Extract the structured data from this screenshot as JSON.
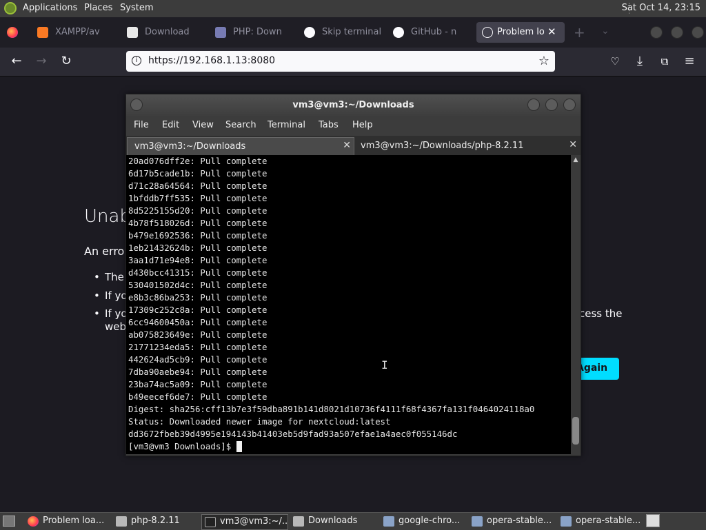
{
  "top_panel": {
    "applications": "Applications",
    "places": "Places",
    "system": "System",
    "clock": "Sat Oct 14, 23:15"
  },
  "browser": {
    "tabs": [
      {
        "label": "XAMPP/av",
        "icon": "xampp-icon"
      },
      {
        "label": "Download",
        "icon": "download-page-icon"
      },
      {
        "label": "PHP: Down",
        "icon": "php-icon"
      },
      {
        "label": "Skip terminal",
        "icon": "github-icon"
      },
      {
        "label": "GitHub - n",
        "icon": "github-icon"
      },
      {
        "label": "Problem lo",
        "icon": "info-icon"
      }
    ],
    "url": "https://192.168.1.13:8080"
  },
  "error_page": {
    "title_fragment": "Unab",
    "intro_fragment": "An erro",
    "bullet_1": "The",
    "bullet_2": "If yo",
    "bullet_3a": "If yo",
    "bullet_3b": "web",
    "bullet_3_tail": "cess the",
    "button": "Again"
  },
  "terminal": {
    "title": "vm3@vm3:~/Downloads",
    "menu": [
      "File",
      "Edit",
      "View",
      "Search",
      "Terminal",
      "Tabs",
      "Help"
    ],
    "tabs": [
      {
        "label": "vm3@vm3:~/Downloads"
      },
      {
        "label": "vm3@vm3:~/Downloads/php-8.2.11"
      }
    ],
    "lines": [
      "20ad076dff2e: Pull complete",
      "6d17b5cade1b: Pull complete",
      "d71c28a64564: Pull complete",
      "1bfddb7ff535: Pull complete",
      "8d5225155d20: Pull complete",
      "4b78f518026d: Pull complete",
      "b479e1692536: Pull complete",
      "1eb21432624b: Pull complete",
      "3aa1d71e94e8: Pull complete",
      "d430bcc41315: Pull complete",
      "530401502d4c: Pull complete",
      "e8b3c86ba253: Pull complete",
      "17309c252c8a: Pull complete",
      "6cc94600450a: Pull complete",
      "ab075823649e: Pull complete",
      "21771234eda5: Pull complete",
      "442624ad5cb9: Pull complete",
      "7dba90aebe94: Pull complete",
      "23ba74ac5a09: Pull complete",
      "b49eecef6de7: Pull complete",
      "Digest: sha256:cff13b7e3f59dba891b141d8021d10736f4111f68f4367fa131f0464024118a0",
      "Status: Downloaded newer image for nextcloud:latest",
      "dd3672fbeb39d4995e194143b41403eb5d9fad93a507efae1a4aec0f055146dc"
    ],
    "prompt": "[vm3@vm3 Downloads]$ "
  },
  "taskbar": {
    "items": [
      {
        "label": "Problem loa...",
        "icon": "firefox-icon"
      },
      {
        "label": "php-8.2.11",
        "icon": "folder-icon"
      },
      {
        "label": "vm3@vm3:~/...",
        "icon": "terminal-icon"
      },
      {
        "label": "Downloads",
        "icon": "folder-icon"
      },
      {
        "label": "google-chro...",
        "icon": "package-icon"
      },
      {
        "label": "opera-stable...",
        "icon": "package-icon"
      },
      {
        "label": "opera-stable...",
        "icon": "package-icon"
      }
    ]
  }
}
